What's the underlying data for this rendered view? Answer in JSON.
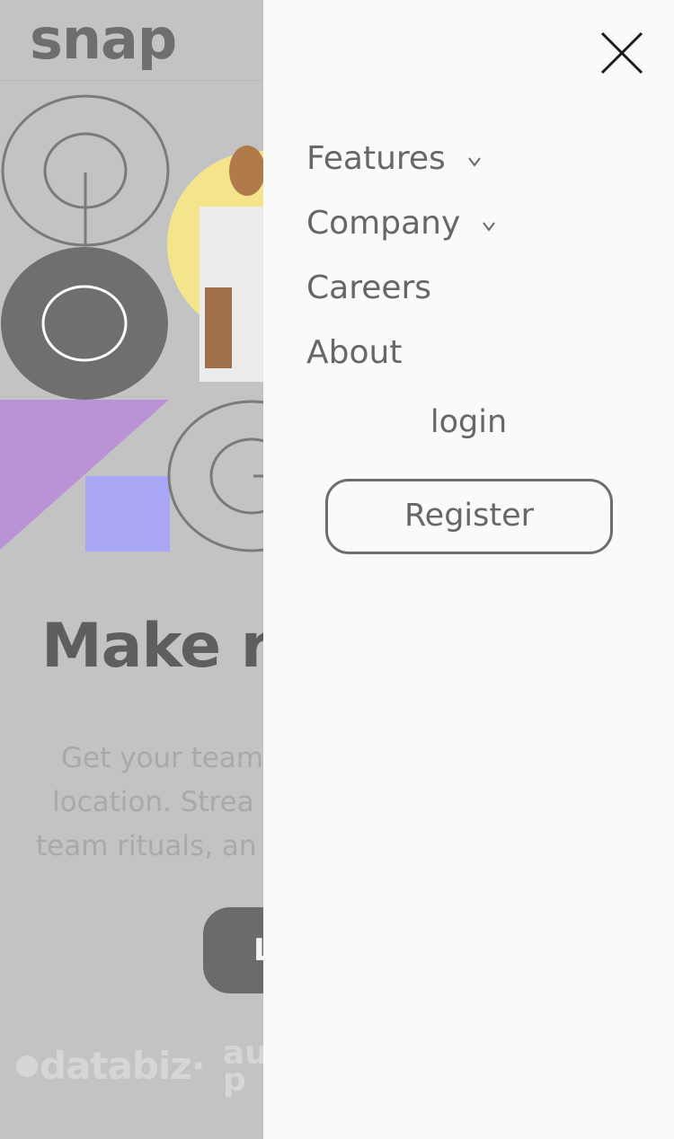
{
  "header": {
    "logo": "snap"
  },
  "hero": {
    "headline": "Make re",
    "subtext_lines": [
      "Get your team",
      "location. Strea",
      "team rituals, an"
    ],
    "cta_label": "L"
  },
  "brands": [
    "databiz",
    "au\np"
  ],
  "drawer": {
    "close_icon": "close-icon",
    "nav": [
      {
        "label": "Features",
        "has_dropdown": true
      },
      {
        "label": "Company",
        "has_dropdown": true
      },
      {
        "label": "Careers",
        "has_dropdown": false
      },
      {
        "label": "About",
        "has_dropdown": false
      }
    ],
    "login_label": "login",
    "register_label": "Register"
  },
  "colors": {
    "overlay_bg": "#c3c3c3",
    "drawer_bg": "#fafafa",
    "text": "#676767",
    "purple": "#b993d6",
    "lavender": "#a8a6f5",
    "yellow": "#f4e58c"
  }
}
